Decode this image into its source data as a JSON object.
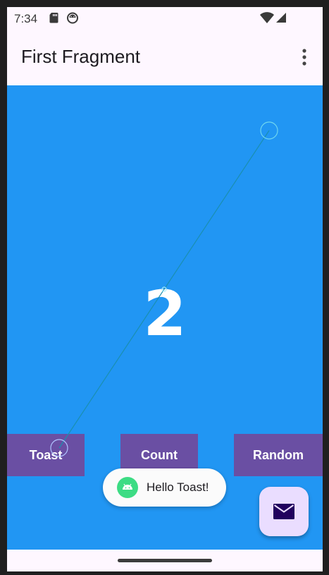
{
  "status_bar": {
    "time": "7:34",
    "icons": [
      "sd-card-icon",
      "android-debug-icon",
      "wifi-icon",
      "cellular-signal-icon"
    ]
  },
  "app_bar": {
    "title": "First Fragment",
    "menu_icon": "more-vert-icon"
  },
  "content": {
    "count_value": "2",
    "background_color": "#2196f3"
  },
  "buttons": {
    "toast_label": "Toast",
    "count_label": "Count",
    "random_label": "Random",
    "color": "#6a4fa3"
  },
  "toast": {
    "message": "Hello Toast!",
    "icon": "android-icon"
  },
  "fab": {
    "icon": "mail-icon",
    "color": "#eaddff"
  },
  "nav_bar": {
    "handle": "gesture-handle"
  }
}
